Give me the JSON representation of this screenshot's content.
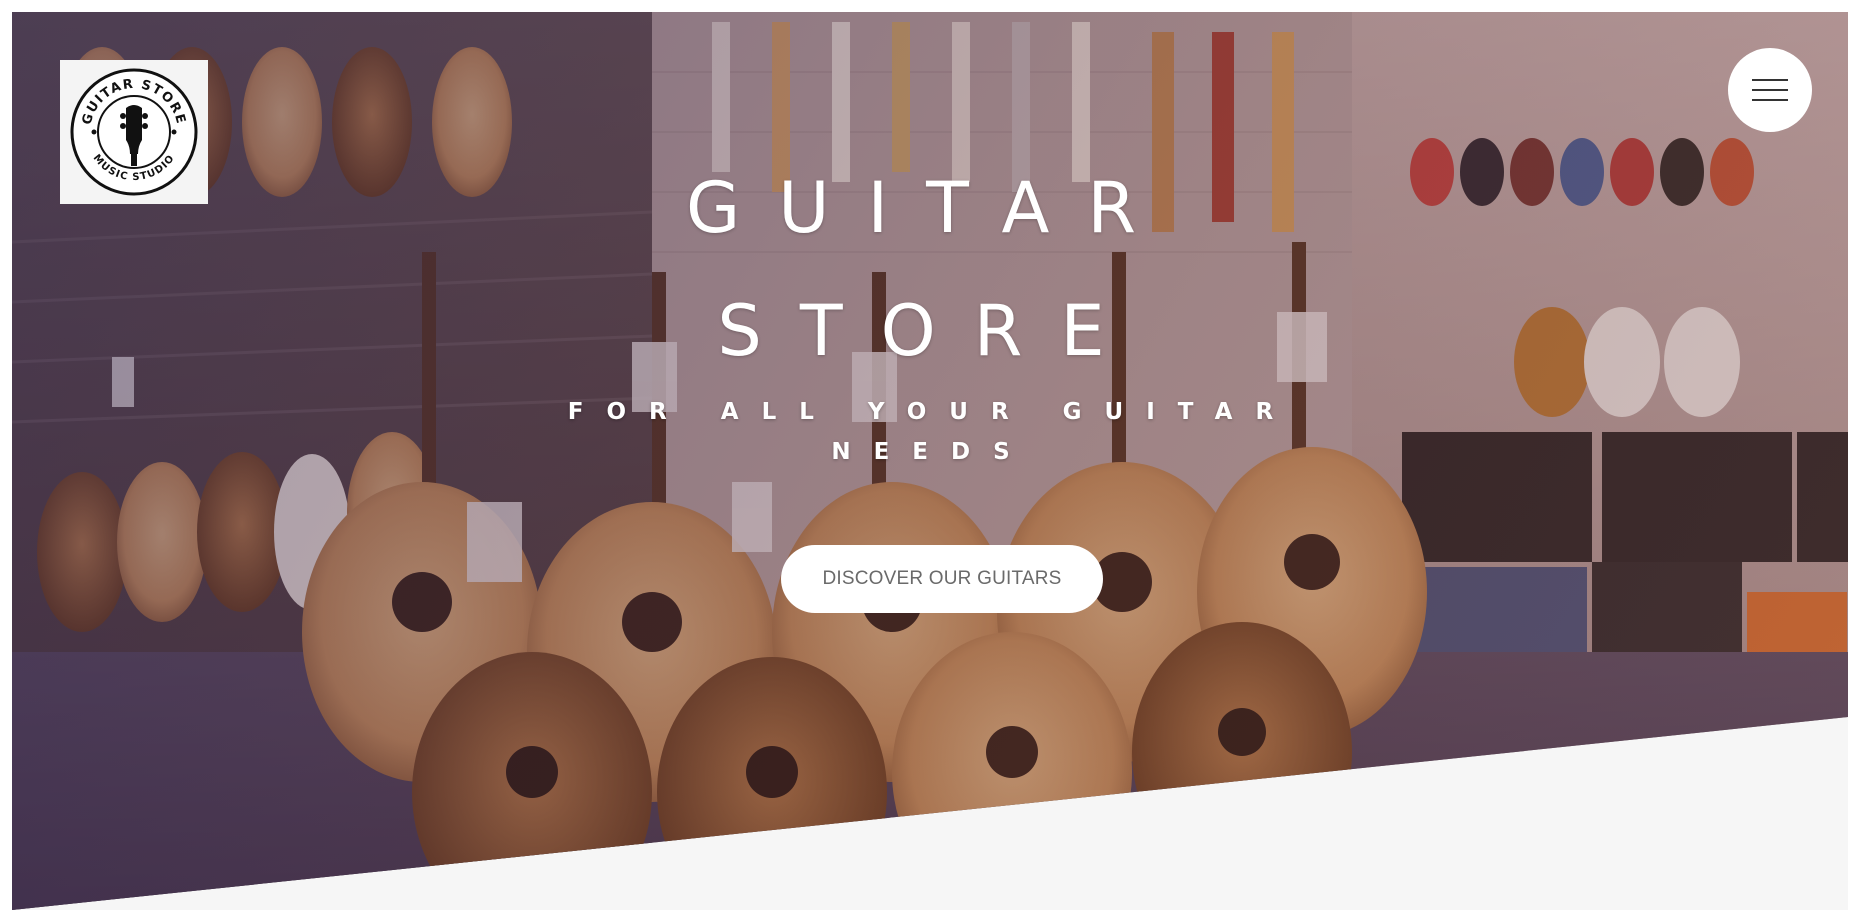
{
  "brand": {
    "logo_icon": "guitar-headstock-icon",
    "logo_ring_top": "GUITAR STORE",
    "logo_ring_bottom": "MUSIC STUDIO"
  },
  "header": {
    "menu_icon": "hamburger-menu-icon"
  },
  "hero": {
    "title_line1": "GUITAR",
    "title_line2": "STORE",
    "tagline": "FOR ALL YOUR GUITAR NEEDS",
    "cta_label": "DISCOVER OUR GUITARS",
    "background_image": "guitar-shop-interior-photo"
  },
  "colors": {
    "overlay_tint": "#6b4a6a",
    "page_background": "#f6f6f6",
    "button_background": "#ffffff",
    "button_text": "#6a6a6a"
  }
}
